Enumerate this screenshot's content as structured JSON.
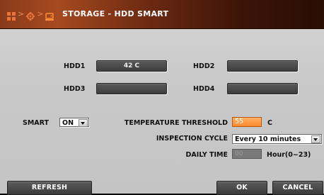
{
  "title": {
    "icons": [
      "grid-icon",
      "gear-icon",
      "storage-icon"
    ],
    "text": "STORAGE - HDD SMART"
  },
  "hdd": [
    {
      "label": "HDD1",
      "value": "42 C"
    },
    {
      "label": "HDD2",
      "value": ""
    },
    {
      "label": "HDD3",
      "value": ""
    },
    {
      "label": "HDD4",
      "value": ""
    }
  ],
  "smart": {
    "label": "SMART",
    "value": "ON"
  },
  "threshold": {
    "label": "TEMPERATURE THRESHOLD",
    "value": "55",
    "unit": "C"
  },
  "inspection": {
    "label": "INSPECTION CYCLE",
    "value": "Every 10 minutes"
  },
  "daily": {
    "label": "DAILY TIME",
    "value": "00",
    "unit": "Hour(0~23)"
  },
  "buttons": {
    "refresh": "REFRESH",
    "ok": "OK",
    "cancel": "CANCEL"
  },
  "colors": {
    "accent": "#ff8a2a",
    "title_bar": "#8a3a1a"
  }
}
